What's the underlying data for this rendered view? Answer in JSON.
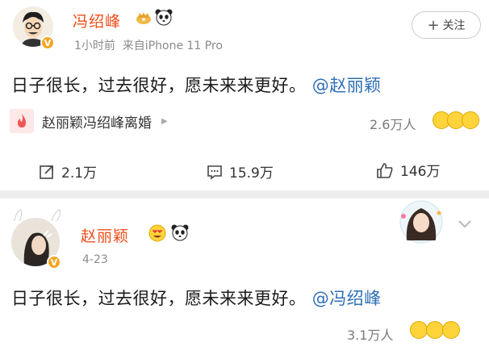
{
  "post1": {
    "author": "冯绍峰",
    "meta": "1小时前  来自iPhone 11 Pro",
    "follow_label": "关注",
    "text": "日子很长，过去很好，愿未来来更好。",
    "mention": "@赵丽颖",
    "topic": "赵丽颖冯绍峰离婚",
    "reaction_count": "2.6万人",
    "actions": {
      "repost": "2.1万",
      "comment": "15.9万",
      "like": "146万"
    }
  },
  "post2": {
    "author": "赵丽颖",
    "meta": "4-23",
    "text": "日子很长，过去很好，愿未来来更好。",
    "mention": "@冯绍峰",
    "reaction_count": "3.1万人"
  },
  "colors": {
    "name": "#f04d1a",
    "mention": "#2e6fb6",
    "vip_badge": "#f5a623"
  }
}
